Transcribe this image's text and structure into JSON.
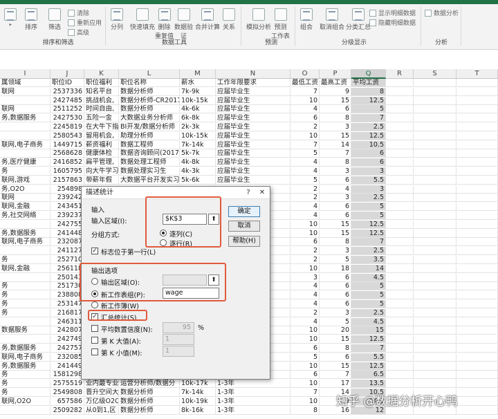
{
  "ribbon": {
    "buttons": {
      "sort": "排序",
      "filter": "筛选",
      "split": "分列",
      "flash": "快速填充",
      "dup": "删除\n重复值",
      "valid": "数据验\n证",
      "merge": "合并计算",
      "relation": "关系",
      "whatif": "模拟分析",
      "forecast": "预测\n工作表",
      "group": "组合",
      "ungroup": "取消组合",
      "subtotal": "分类汇总",
      "analysis": "数据分析"
    },
    "small": {
      "clear": "清除",
      "reapply": "重新应用",
      "advanced": "高级",
      "show_detail": "显示明细数据",
      "hide_detail": "隐藏明细数据"
    },
    "groups": {
      "sortfilter": "排序和筛选",
      "datatools": "数据工具",
      "forecast": "预测",
      "outline": "分级显示",
      "analysis": "分析"
    }
  },
  "grid": {
    "cols": [
      "I",
      "J",
      "K",
      "L",
      "M",
      "N",
      "O",
      "P",
      "Q",
      "R",
      "S",
      "T"
    ],
    "headers": [
      "属领域",
      "职位ID",
      "职位福利",
      "职位名称",
      "薪水",
      "工作年限要求",
      "最低工资",
      "最高工资",
      "平均工资"
    ],
    "rows": [
      [
        "联网",
        "2537336",
        "知名平台",
        "数据分析师",
        "7k-9k",
        "应届毕业生",
        "7",
        "9",
        "8"
      ],
      [
        "",
        "2427485",
        "挑战机会,",
        "数据分析师-CR2017",
        "10k-15k",
        "应届毕业生",
        "10",
        "15",
        "12.5"
      ],
      [
        "联网",
        "2511252",
        "时间自由,",
        "数据分析师",
        "4k-6k",
        "应届毕业生",
        "4",
        "6",
        "5"
      ],
      [
        "务,数据服务",
        "2427530",
        "五险一金",
        "大数据业务分析师",
        "6k-8k",
        "应届毕业生",
        "6",
        "8",
        "7"
      ],
      [
        "",
        "2245819",
        "在大牛下指",
        "BI开发/数据分析师",
        "2k-3k",
        "应届毕业生",
        "2",
        "3",
        "2.5"
      ],
      [
        "",
        "2580543",
        "留用机会,",
        "助理分析师",
        "10k-15k",
        "应届毕业生",
        "10",
        "15",
        "12.5"
      ],
      [
        "联网,电子商务",
        "1449715",
        "薪资福利",
        "数据工程师",
        "7k-14k",
        "应届毕业生",
        "7",
        "14",
        "10.5"
      ],
      [
        "",
        "2568628",
        "健康体检",
        "数据咨询顾问(2017",
        "5k-7k",
        "应届毕业生",
        "5",
        "7",
        "6"
      ],
      [
        "务,医疗健康",
        "2416852",
        "扁平管理,",
        "数据处理工程师",
        "4k-8k",
        "应届毕业生",
        "4",
        "8",
        "6"
      ],
      [
        "务",
        "1605795",
        "向大牛学习",
        "数据处理实习生",
        "4k-3k",
        "应届毕业生",
        "4",
        "3",
        "3"
      ],
      [
        "联网,游戏",
        "2157863",
        "带薪年假",
        "大数据平台开发实习",
        "5k-6k",
        "应届毕业生",
        "5",
        "6",
        "5.5"
      ],
      [
        "务,O2O",
        "254898",
        "",
        "",
        "",
        "",
        "2",
        "4",
        "3"
      ],
      [
        "联网",
        "239242",
        "",
        "",
        "",
        "",
        "2",
        "3",
        "2.5"
      ],
      [
        "联网,金融",
        "243451",
        "",
        "",
        "",
        "",
        "4",
        "6",
        "5"
      ],
      [
        "务,社交网络",
        "239237",
        "",
        "",
        "",
        "",
        "4",
        "6",
        "5"
      ],
      [
        "",
        "242755",
        "",
        "",
        "",
        "",
        "10",
        "15",
        "12.5"
      ],
      [
        "务,数据服务",
        "241448",
        "",
        "",
        "",
        "",
        "10",
        "15",
        "12.5"
      ],
      [
        "联网,电子商务",
        "232087",
        "",
        "",
        "",
        "",
        "6",
        "8",
        "7"
      ],
      [
        "",
        "241127",
        "",
        "",
        "",
        "",
        "2",
        "3",
        "2.5"
      ],
      [
        "务",
        "252710",
        "",
        "",
        "",
        "",
        "2",
        "5",
        "3.5"
      ],
      [
        "联网,金融",
        "256118",
        "",
        "",
        "",
        "",
        "10",
        "18",
        "14"
      ],
      [
        "",
        "250143",
        "",
        "",
        "",
        "",
        "3",
        "6",
        "4.5"
      ],
      [
        "务",
        "251730",
        "",
        "",
        "",
        "",
        "4",
        "6",
        "5"
      ],
      [
        "务",
        "238808",
        "",
        "",
        "",
        "",
        "4",
        "6",
        "5"
      ],
      [
        "务",
        "253147",
        "",
        "",
        "",
        "",
        "4",
        "6",
        "5"
      ],
      [
        "务",
        "216817",
        "",
        "",
        "",
        "",
        "2",
        "3",
        "2.5"
      ],
      [
        "",
        "246311",
        "",
        "",
        "",
        "",
        "4",
        "5",
        "4.5"
      ],
      [
        "数据服务",
        "242807",
        "",
        "",
        "",
        "",
        "10",
        "20",
        "15"
      ],
      [
        "",
        "242749",
        "",
        "",
        "",
        "",
        "10",
        "15",
        "12.5"
      ],
      [
        "务,数据服务",
        "242757",
        "",
        "",
        "",
        "",
        "6",
        "8",
        "7"
      ],
      [
        "联网,电子商务",
        "232085",
        "",
        "",
        "",
        "",
        "5",
        "6",
        "5.5"
      ],
      [
        "务,数据服务",
        "241449",
        "",
        "",
        "",
        "",
        "10",
        "15",
        "12.5"
      ],
      [
        "务",
        "1581298",
        "",
        "",
        "",
        "",
        "6",
        "7",
        "6.5"
      ],
      [
        "务",
        "2575519",
        "业内最专业",
        "运营分析师/数据分",
        "10k-17k",
        "1-3年",
        "10",
        "17",
        "13.5"
      ],
      [
        "务",
        "2549808",
        "晋升空间大",
        "数据分析师",
        "7k-14k",
        "1-3年",
        "7",
        "14",
        "10.5"
      ],
      [
        "联网,O2O",
        "657586",
        "万亿级O2O",
        "数据分析师",
        "10k-19k",
        "1-3年",
        "10",
        "19",
        "14.5"
      ],
      [
        "",
        "2509282",
        "从0到1,区",
        "数据分析师",
        "8k-16k",
        "1-3年",
        "8",
        "16",
        "12"
      ]
    ]
  },
  "dialog": {
    "title": "描述统计",
    "help": "?",
    "close": "✕",
    "input_section": "输入",
    "input_range_label": "输入区域(I):",
    "input_range_value": "$K$3",
    "group_label": "分组方式:",
    "by_col": "逐列(C)",
    "by_row": "逐行(R)",
    "first_row_label": "标志位于第一行(L)",
    "output_section": "输出选项",
    "output_range_label": "输出区域(O):",
    "new_sheet_label": "新工作表组(P):",
    "new_sheet_value": "wage",
    "new_book_label": "新工作簿(W)",
    "summary_label": "汇总统计(S)",
    "confidence_label": "平均数置信度(N):",
    "confidence_value": "95",
    "percent": "%",
    "kth_largest_label": "第 K 大值(A):",
    "kth_largest_value": "1",
    "kth_smallest_label": "第 K 小值(M):",
    "kth_smallest_value": "1",
    "ok": "确定",
    "cancel": "取消",
    "help_btn": "帮助(H)"
  },
  "watermark": "知乎 @数据分析开心鸭",
  "colors": {
    "accent": "#217346",
    "highlight": "#e05a3c"
  }
}
